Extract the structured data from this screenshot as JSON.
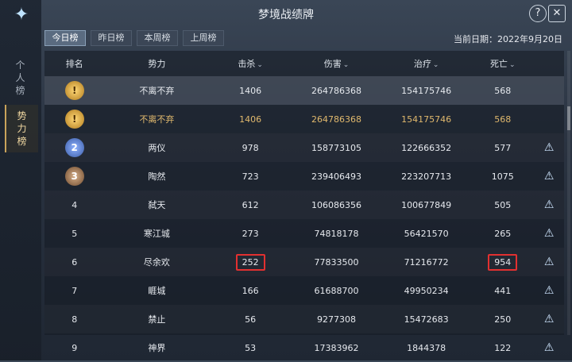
{
  "window": {
    "title": "梦境战绩牌",
    "help": "?",
    "close": "✕"
  },
  "sidebar": {
    "tabs": [
      {
        "label": "个\n人\n榜",
        "active": false
      },
      {
        "label": "势\n力\n榜",
        "active": true
      }
    ]
  },
  "tabs": [
    "今日榜",
    "昨日榜",
    "本周榜",
    "上周榜"
  ],
  "date": "当前日期：2022年9月20日",
  "table": {
    "headers": [
      "排名",
      "势力",
      "击杀",
      "伤害",
      "治疗",
      "死亡"
    ],
    "rows": [
      {
        "rank": "1",
        "name": "不离不弃",
        "kill": "1406",
        "damage": "264786368",
        "heal": "154175746",
        "death": "568"
      },
      {
        "rank": "1",
        "name": "不离不弃",
        "kill": "1406",
        "damage": "264786368",
        "heal": "154175746",
        "death": "568"
      },
      {
        "rank": "2",
        "name": "两仪",
        "kill": "978",
        "damage": "158773105",
        "heal": "122666352",
        "death": "577"
      },
      {
        "rank": "3",
        "name": "陶然",
        "kill": "723",
        "damage": "239406493",
        "heal": "223207713",
        "death": "1075"
      },
      {
        "rank": "4",
        "name": "弑天",
        "kill": "612",
        "damage": "106086356",
        "heal": "100677849",
        "death": "505"
      },
      {
        "rank": "5",
        "name": "寒江城",
        "kill": "273",
        "damage": "74818178",
        "heal": "56421570",
        "death": "265"
      },
      {
        "rank": "6",
        "name": "尽余欢",
        "kill": "252",
        "damage": "77833500",
        "heal": "71216772",
        "death": "954"
      },
      {
        "rank": "7",
        "name": "睚城",
        "kill": "166",
        "damage": "61688700",
        "heal": "49950234",
        "death": "441"
      },
      {
        "rank": "8",
        "name": "禁止",
        "kill": "56",
        "damage": "9277308",
        "heal": "15472683",
        "death": "250"
      },
      {
        "rank": "9",
        "name": "神界",
        "kill": "53",
        "damage": "17383962",
        "heal": "1844378",
        "death": "122"
      }
    ]
  }
}
